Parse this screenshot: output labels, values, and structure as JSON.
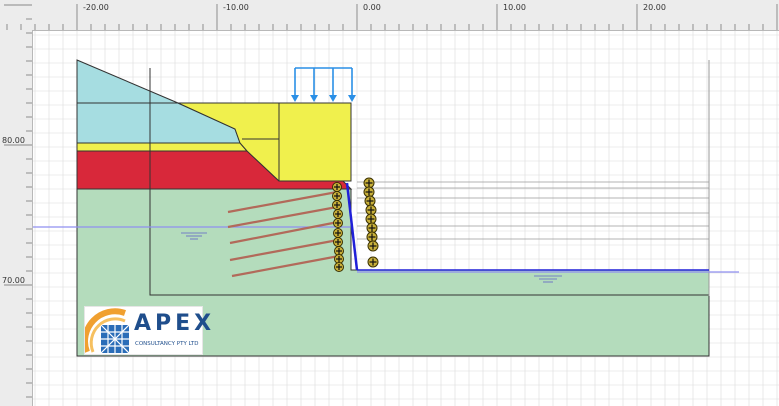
{
  "ruler": {
    "x_labels": [
      "-20.00",
      "-10.00",
      "0.00",
      "10.00",
      "20.00"
    ],
    "y_labels": [
      "80.00",
      "70.00"
    ]
  },
  "logo": {
    "name": "APEX",
    "subtitle": "CONSULTANCY PTY LTD"
  },
  "colors": {
    "soil_top_wedge": "#a6dde1",
    "fill_yellow": "#f0f04d",
    "clay_red": "#d8283a",
    "base_green": "#b4dcbc",
    "water_line": "#8f8ff0",
    "wall_blue": "#2020d8",
    "anchor_brown": "#b26a5a",
    "load_arrow": "#2a8fe6",
    "node_olive": "#c9b13a",
    "logo_blue": "#1f4e8c",
    "logo_orange": "#f0a030"
  }
}
